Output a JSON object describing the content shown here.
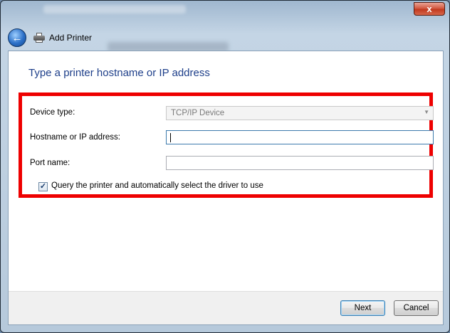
{
  "window": {
    "title": "Add Printer",
    "close_symbol": "x"
  },
  "page": {
    "heading": "Type a printer hostname or IP address"
  },
  "form": {
    "device_type": {
      "label": "Device type:",
      "value": "TCP/IP Device"
    },
    "hostname": {
      "label": "Hostname or IP address:",
      "value": ""
    },
    "port": {
      "label": "Port name:",
      "value": ""
    },
    "query_checkbox": {
      "label": "Query the printer and automatically select the driver to use",
      "checked": true,
      "check_symbol": "✓"
    }
  },
  "buttons": {
    "next": "Next",
    "cancel": "Cancel"
  },
  "icons": {
    "back": "back-arrow-icon",
    "printer": "printer-icon"
  },
  "colors": {
    "highlight": "#ee0000",
    "heading": "#1e3f8a"
  }
}
